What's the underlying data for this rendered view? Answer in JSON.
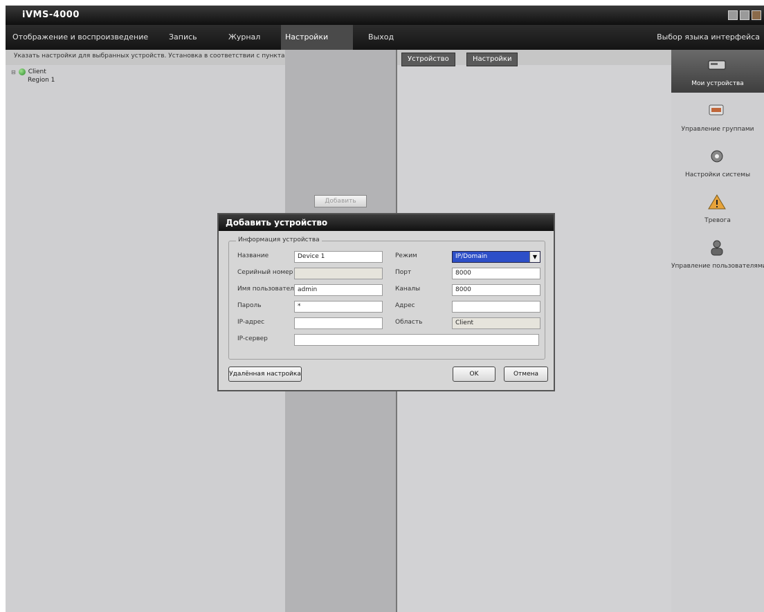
{
  "window": {
    "title": "iVMS-4000"
  },
  "menu": {
    "items": [
      {
        "label": "Отображение и воспроизведение"
      },
      {
        "label": "Запись"
      },
      {
        "label": "Журнал"
      },
      {
        "label": "Настройки"
      },
      {
        "label": "Выход"
      }
    ],
    "right_label": "Выбор языка интерфейса"
  },
  "path_bar": {
    "text": "Указать настройки для выбранных устройств. Установка в соответствии с пунктами"
  },
  "tree": {
    "root": "Client",
    "child": "Region 1"
  },
  "mid_button": {
    "label": "Добавить"
  },
  "tabs": [
    {
      "label": "Устройство"
    },
    {
      "label": "Настройки"
    }
  ],
  "sidebar": {
    "items": [
      {
        "label": "Мои устройства",
        "icon": "server-icon"
      },
      {
        "label": "Управление группами",
        "icon": "camera-group-icon"
      },
      {
        "label": "Настройки системы",
        "icon": "gear-icon"
      },
      {
        "label": "Тревога",
        "icon": "warning-icon"
      },
      {
        "label": "Управление пользователями",
        "icon": "user-icon"
      }
    ]
  },
  "dialog": {
    "title": "Добавить устройство",
    "group_legend": "Информация устройства",
    "fields": {
      "device_name": {
        "label": "Название",
        "value": "Device 1"
      },
      "serial": {
        "label": "Серийный номер",
        "value": ""
      },
      "user_name": {
        "label": "Имя пользователя",
        "value": "admin"
      },
      "password": {
        "label": "Пароль",
        "value": "*"
      },
      "ip_address": {
        "label": "IP-адрес",
        "value": ""
      },
      "ip_server": {
        "label": "IP-сервер",
        "value": ""
      },
      "register_mode": {
        "label": "Режим",
        "value": "IP/Domain"
      },
      "port": {
        "label": "Порт",
        "value": "8000"
      },
      "channels": {
        "label": "Каналы",
        "value": "8000"
      },
      "multicast": {
        "label": "Адрес",
        "value": ""
      },
      "region": {
        "label": "Область",
        "value": "Client"
      }
    },
    "buttons": {
      "remote_config": "Удалённая настройка",
      "ok": "OK",
      "cancel": "Отмена"
    }
  }
}
